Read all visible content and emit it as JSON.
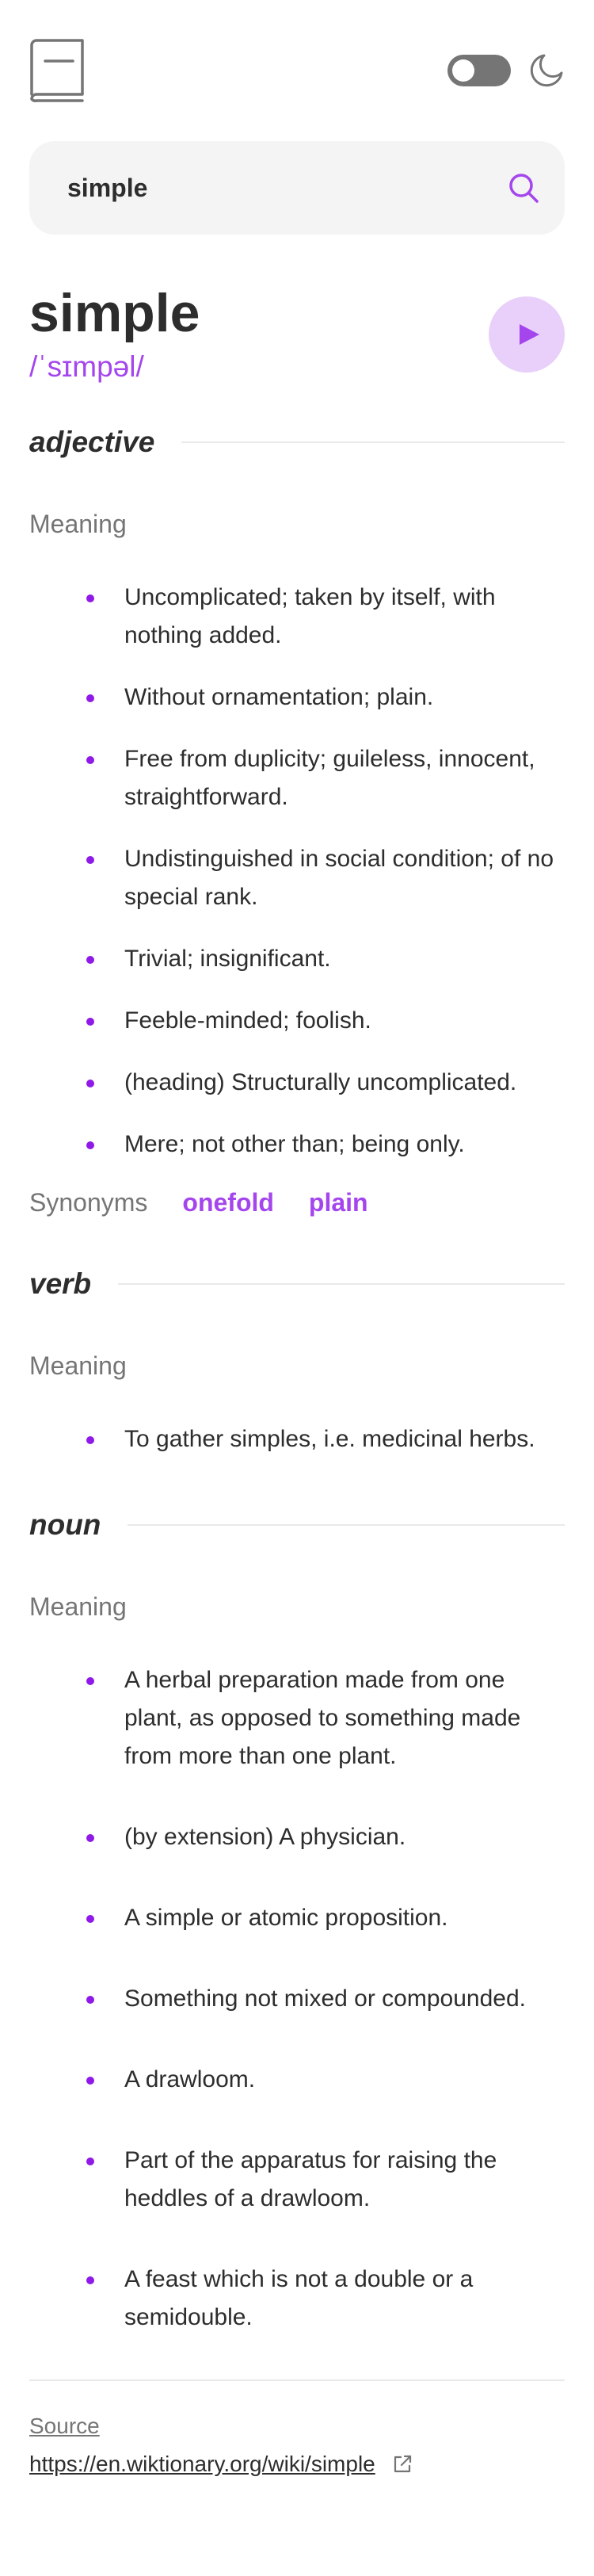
{
  "header": {
    "logo_icon": "book-icon",
    "theme_toggle_icon": "toggle-icon",
    "theme_icon": "moon-icon"
  },
  "search": {
    "value": "simple",
    "icon": "search-icon",
    "accent": "#a445ed"
  },
  "word": {
    "title": "simple",
    "phonetic": "/ˈsɪmpəl/",
    "play_icon": "play-icon"
  },
  "meanings": {
    "adjective": {
      "part_of_speech": "adjective",
      "meaning_label": "Meaning",
      "definitions": [
        "Uncomplicated; taken by itself, with nothing added.",
        "Without ornamentation; plain.",
        "Free from duplicity; guileless, innocent, straightforward.",
        "Undistinguished in social condition; of no special rank.",
        "Trivial; insignificant.",
        "Feeble-minded; foolish.",
        "(heading) Structurally uncomplicated.",
        "Mere; not other than; being only."
      ],
      "synonyms_label": "Synonyms",
      "synonyms": [
        "onefold",
        "plain"
      ]
    },
    "verb": {
      "part_of_speech": "verb",
      "meaning_label": "Meaning",
      "definitions": [
        "To gather simples, i.e. medicinal herbs."
      ]
    },
    "noun": {
      "part_of_speech": "noun",
      "meaning_label": "Meaning",
      "definitions": [
        "A herbal preparation made from one plant, as opposed to something made from more than one plant.",
        "(by extension) A physician.",
        "A simple or atomic proposition.",
        "Something not mixed or compounded.",
        "A drawloom.",
        "Part of the apparatus for raising the heddles of a drawloom.",
        "A feast which is not a double or a semidouble."
      ]
    }
  },
  "source": {
    "label": "Source",
    "url": "https://en.wiktionary.org/wiki/simple",
    "icon": "external-link-icon"
  },
  "colors": {
    "accent": "#a445ed",
    "bullet": "#8f19e8",
    "text": "#2d2d2d",
    "muted": "#757575",
    "play_bg": "#e9d0fa",
    "search_bg": "#f4f4f4"
  }
}
